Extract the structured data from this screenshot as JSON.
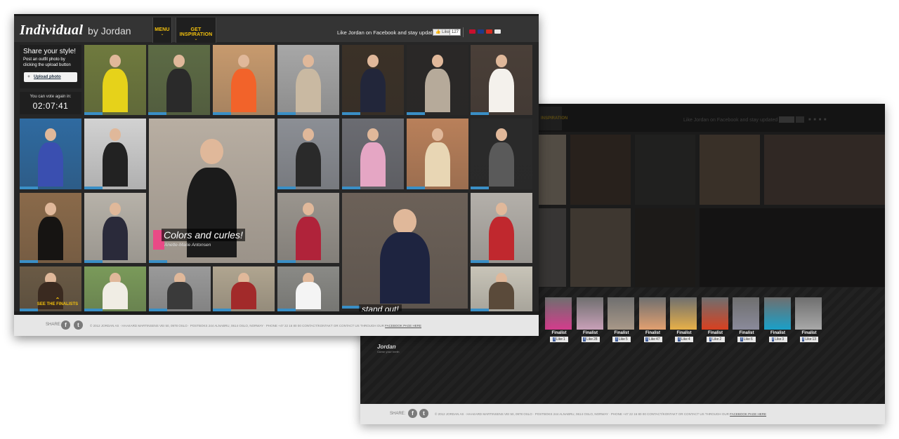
{
  "front": {
    "brand": {
      "name": "Individual",
      "sub": "by Jordan"
    },
    "nav": [
      {
        "label": "MENU"
      },
      {
        "label": "GET INSPIRATION"
      }
    ],
    "facebook": {
      "text": "Like Jordan on Facebook and stay updated",
      "like_label": "Like",
      "like_count": "127"
    },
    "flags": [
      "#c8102e",
      "#1e3a8a",
      "#d52b1e",
      "#e8e8e8"
    ],
    "share_box": {
      "title": "Share your style!",
      "desc": "Post an outfit photo by clicking the upload button",
      "upload": "Upload photo"
    },
    "vote_box": {
      "label": "You can vote again in:",
      "time": "02:07:41"
    },
    "featured": {
      "title": "Colors and curles!",
      "author": "Anette-Marie Antonsen"
    },
    "finalists_link": "SEE THE FINALISTS",
    "standout": "stand out!",
    "footer": {
      "share": "SHARE:",
      "copyright": "© 2012 JORDAN AS · HAAKARD MARTINSENS VEI 50, 0978 OSLO · POSTBOKS 244 ALNABRU, 0614 OSLO, NORWAY · PHONE +47 22 16 80 00 CONTACT/KONTAKT OR CONTACT US THROUGH OUR",
      "link": "FACEBOOK PAGE HERE"
    }
  },
  "back": {
    "nav_label": "INSPIRATION",
    "facebook_text": "Like Jordan on Facebook and stay updated",
    "finalists": [
      {
        "label": "Finalist",
        "likes": "1"
      },
      {
        "label": "Finalist",
        "likes": "28"
      },
      {
        "label": "Finalist",
        "likes": "5"
      },
      {
        "label": "Finalist",
        "likes": "47"
      },
      {
        "label": "Finalist",
        "likes": "4"
      },
      {
        "label": "Finalist",
        "likes": "2"
      },
      {
        "label": "Finalist",
        "likes": "6"
      },
      {
        "label": "Finalist",
        "likes": "3"
      },
      {
        "label": "Finalist",
        "likes": "13"
      }
    ],
    "like_label": "Like",
    "logo": {
      "name": "Jordan",
      "tag": "Come your teeth"
    },
    "footer": {
      "share": "SHARE:",
      "copyright": "© 2012 JORDAN AS · HAAKARD MARTINSENS VEI 50, 0978 OSLO · POSTBOKS 244 ALNABRU, 0614 OSLO, NORWAY · PHONE +47 22 16 80 00 CONTACT/KONTAKT OR CONTACT US THROUGH OUR",
      "link": "FACEBOOK PAGE HERE"
    }
  }
}
